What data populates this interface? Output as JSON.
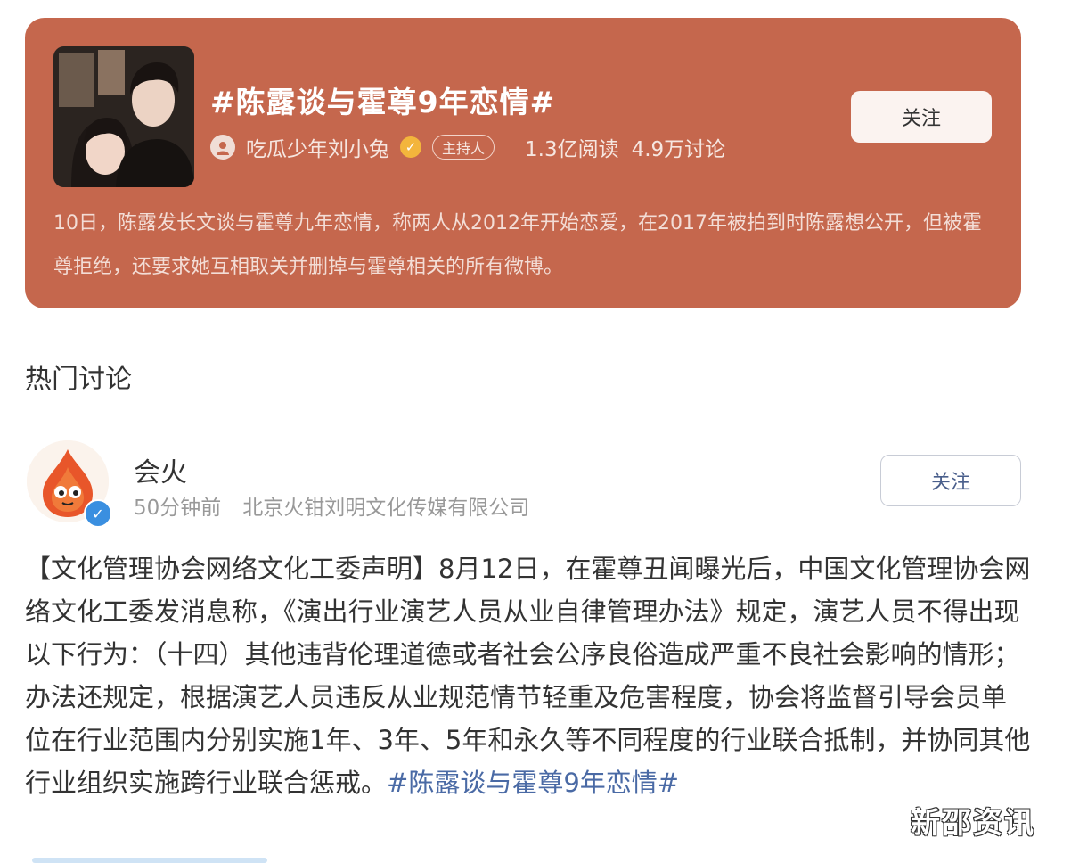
{
  "topic": {
    "title": "#陈露谈与霍尊9年恋情#",
    "host_name": "吃瓜少年刘小兔",
    "host_badge": "主持人",
    "reads": "1.3亿阅读",
    "discussions": "4.9万讨论",
    "follow_label": "关注",
    "description": "10日，陈露发长文谈与霍尊九年恋情，称两人从2012年开始恋爱，在2017年被拍到时陈露想公开，但被霍尊拒绝，还要求她互相取关并删掉与霍尊相关的所有微博。",
    "card_color": "#c5674d"
  },
  "section": {
    "title": "热门讨论"
  },
  "post": {
    "author": "会火",
    "time": "50分钟前",
    "source": "北京火钳刘明文化传媒有限公司",
    "follow_label": "关注",
    "body": "【文化管理协会网络文化工委声明】8月12日，在霍尊丑闻曝光后，中国文化管理协会网络文化工委发消息称，《演出行业演艺人员从业自律管理办法》规定，演艺人员不得出现以下行为：（十四）其他违背伦理道德或者社会公序良俗造成严重不良社会影响的情形；办法还规定，根据演艺人员违反从业规范情节轻重及危害程度，协会将监督引导会员单位在行业范围内分别实施1年、3年、5年和永久等不同程度的行业联合抵制，并协同其他行业组织实施跨行业联合惩戒。",
    "hashtag": "#陈露谈与霍尊9年恋情#",
    "hashtag_color": "#4a6aa5"
  },
  "watermark": "新邵资讯"
}
